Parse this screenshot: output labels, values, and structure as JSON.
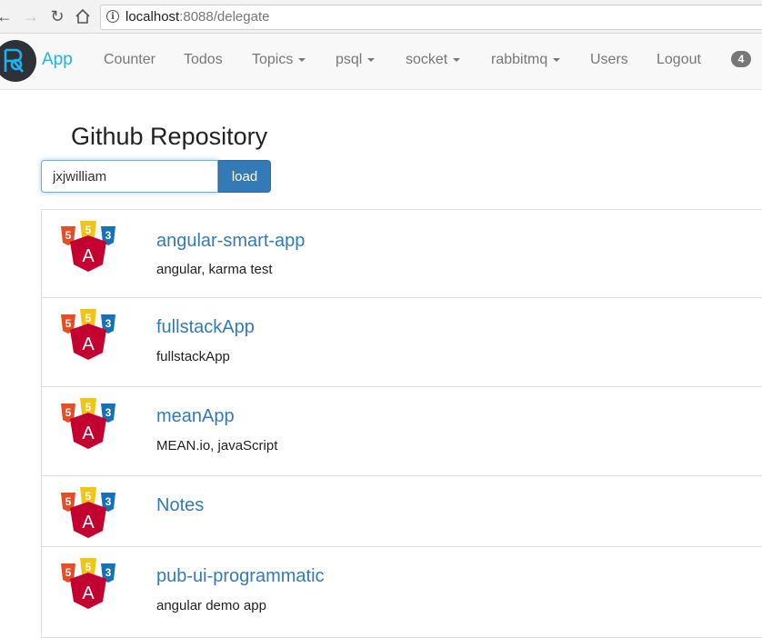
{
  "browser": {
    "url_host": "localhost",
    "url_rest": ":8088/delegate",
    "icons": [
      "back-arrow-icon",
      "forward-arrow-icon",
      "reload-icon",
      "home-icon",
      "info-icon"
    ]
  },
  "navbar": {
    "brand": "App",
    "items": [
      {
        "label": "Counter"
      },
      {
        "label": "Todos"
      },
      {
        "label": "Topics",
        "dropdown": true
      },
      {
        "label": "psql",
        "dropdown": true
      },
      {
        "label": "socket",
        "dropdown": true
      },
      {
        "label": "rabbitmq",
        "dropdown": true
      },
      {
        "label": "Users"
      },
      {
        "label": "Logout"
      }
    ],
    "badge": "4"
  },
  "page": {
    "title": "Github Repository",
    "search_value": "jxjwilliam",
    "load_label": "load"
  },
  "repos": [
    {
      "name": "angular-smart-app",
      "description": "angular, karma test"
    },
    {
      "name": "fullstackApp",
      "description": "fullstackApp"
    },
    {
      "name": "meanApp",
      "description": "MEAN.io, javaScript"
    },
    {
      "name": "Notes",
      "description": ""
    },
    {
      "name": "pub-ui-programmatic",
      "description": "angular demo app"
    }
  ],
  "colors": {
    "brand": "#1ab3f0",
    "link": "#337ab7",
    "html5": "#e44d26",
    "css3": "#1572b6",
    "js": "#f0c419",
    "angular": "#c3002f"
  }
}
